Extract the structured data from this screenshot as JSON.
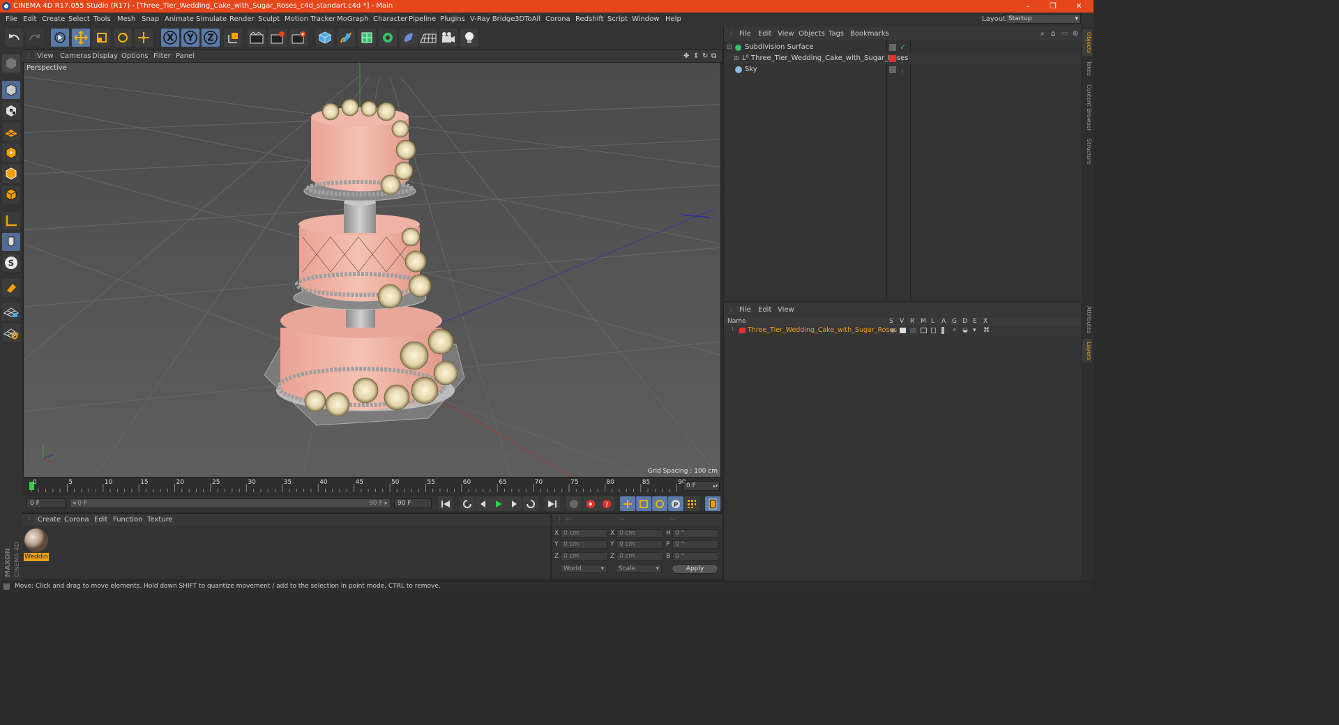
{
  "window": {
    "title": "CINEMA 4D R17.055 Studio (R17) - [Three_Tier_Wedding_Cake_with_Sugar_Roses_c4d_standart.c4d *] - Main",
    "controls": [
      "–",
      "❐",
      "✕"
    ]
  },
  "menu": [
    "File",
    "Edit",
    "Create",
    "Select",
    "Tools",
    "Mesh",
    "Snap",
    "Animate",
    "Simulate",
    "Render",
    "Sculpt",
    "Motion Tracker",
    "MoGraph",
    "Character",
    "Pipeline",
    "Plugins",
    "V-Ray Bridge",
    "3DToAll",
    "Corona",
    "Redshift",
    "Script",
    "Window",
    "Help"
  ],
  "layout": {
    "label": "Layout:",
    "value": "Startup"
  },
  "toolbar": {
    "icons": [
      "undo-icon",
      "redo-icon",
      "select-icon",
      "move-icon",
      "scale-icon",
      "rotate-icon",
      "live-select-icon",
      "x-axis-icon",
      "y-axis-icon",
      "z-axis-icon",
      "coord-system-icon",
      "render-view-icon",
      "render-picture-queue-icon",
      "edit-render-settings-icon",
      "cube-icon",
      "pen-icon",
      "subdivision-icon",
      "array-icon",
      "deformer-icon",
      "floor-icon",
      "camera-icon",
      "light-icon"
    ],
    "axis_labels": [
      "X",
      "Y",
      "Z"
    ]
  },
  "left_tools": [
    "make-editable-icon",
    "model-mode-icon",
    "texture-mode-icon",
    "workplane-icon",
    "points-mode-icon",
    "edges-mode-icon",
    "polygons-mode-icon",
    "axis-icon",
    "tweak-icon",
    "snap-s-icon",
    "magnet-icon",
    "lock-grid-icon",
    "snap-grid-icon"
  ],
  "left_tools_snap_letter": "S",
  "viewport": {
    "menu": [
      "View",
      "Cameras",
      "Display",
      "Options",
      "Filter",
      "Panel"
    ],
    "camera": "Perspective",
    "grid_spacing": "Grid Spacing : 100 cm"
  },
  "timeline": {
    "ticks": [
      "0",
      "5",
      "10",
      "15",
      "20",
      "25",
      "30",
      "35",
      "40",
      "45",
      "50",
      "55",
      "60",
      "65",
      "70",
      "75",
      "80",
      "85",
      "90"
    ],
    "current_frame": "0 F"
  },
  "transport": {
    "start": "0 F",
    "range_start": "◂ 0 F",
    "range_end": "90 F ▸",
    "end": "90 F"
  },
  "materials": {
    "menu": [
      "Create",
      "Corona",
      "Edit",
      "Function",
      "Texture"
    ],
    "items": [
      {
        "name": "Weddin"
      }
    ]
  },
  "coords": {
    "headers": [
      "--",
      "--",
      "--"
    ],
    "rows": [
      {
        "a": "X",
        "av": "0 cm",
        "b": "X",
        "bv": "0 cm",
        "c": "H",
        "cv": "0 °"
      },
      {
        "a": "Y",
        "av": "0 cm",
        "b": "Y",
        "bv": "0 cm",
        "c": "P",
        "cv": "0 °"
      },
      {
        "a": "Z",
        "av": "0 cm",
        "b": "Z",
        "bv": "0 cm",
        "c": "B",
        "cv": "0 °"
      }
    ],
    "world": "World",
    "scale": "Scale",
    "apply": "Apply"
  },
  "objects": {
    "menu": [
      "File",
      "Edit",
      "View",
      "Objects",
      "Tags",
      "Bookmarks"
    ],
    "items": [
      {
        "name": "Subdivision Surface"
      },
      {
        "name": "Three_Tier_Wedding_Cake_with_Sugar_Roses"
      },
      {
        "name": "Sky"
      }
    ]
  },
  "layers": {
    "menu": [
      "File",
      "Edit",
      "View"
    ],
    "name_header": "Name",
    "columns": [
      "S",
      "V",
      "R",
      "M",
      "L",
      "A",
      "G",
      "D",
      "E",
      "X"
    ],
    "items": [
      {
        "name": "Three_Tier_Wedding_Cake_with_Sugar_Roses"
      }
    ]
  },
  "right_tabs": [
    "Objects",
    "Takes",
    "Content Browser",
    "Structure",
    "Attributes",
    "Layers"
  ],
  "brand": "MAXON CINEMA 4D",
  "status": "Move: Click and drag to move elements. Hold down SHIFT to quantize movement / add to the selection in point mode, CTRL to remove.",
  "colors": {
    "titlebar": "#e5461a",
    "accent": "#5a7aa8",
    "highlight": "#f0a020",
    "layer_red": "#e53030"
  }
}
